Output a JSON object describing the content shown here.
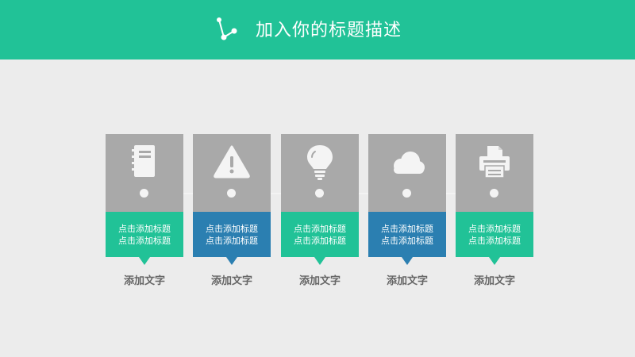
{
  "header": {
    "title": "加入你的标题描述",
    "icon": "share-nodes-icon"
  },
  "colors": {
    "header": "#21c297",
    "teal": "#21c297",
    "blue": "#2b7fb1",
    "card_gray": "#a9a9a9",
    "background": "#ececec",
    "caption_text": "#666666"
  },
  "cards": [
    {
      "icon": "document-icon",
      "line1": "点击添加标题",
      "line2": "点击添加标题",
      "color": "#21c297",
      "caption": "添加文字"
    },
    {
      "icon": "warning-icon",
      "line1": "点击添加标题",
      "line2": "点击添加标题",
      "color": "#2b7fb1",
      "caption": "添加文字"
    },
    {
      "icon": "lightbulb-icon",
      "line1": "点击添加标题",
      "line2": "点击添加标题",
      "color": "#21c297",
      "caption": "添加文字"
    },
    {
      "icon": "cloud-icon",
      "line1": "点击添加标题",
      "line2": "点击添加标题",
      "color": "#2b7fb1",
      "caption": "添加文字"
    },
    {
      "icon": "printer-icon",
      "line1": "点击添加标题",
      "line2": "点击添加标题",
      "color": "#21c297",
      "caption": "添加文字"
    }
  ]
}
